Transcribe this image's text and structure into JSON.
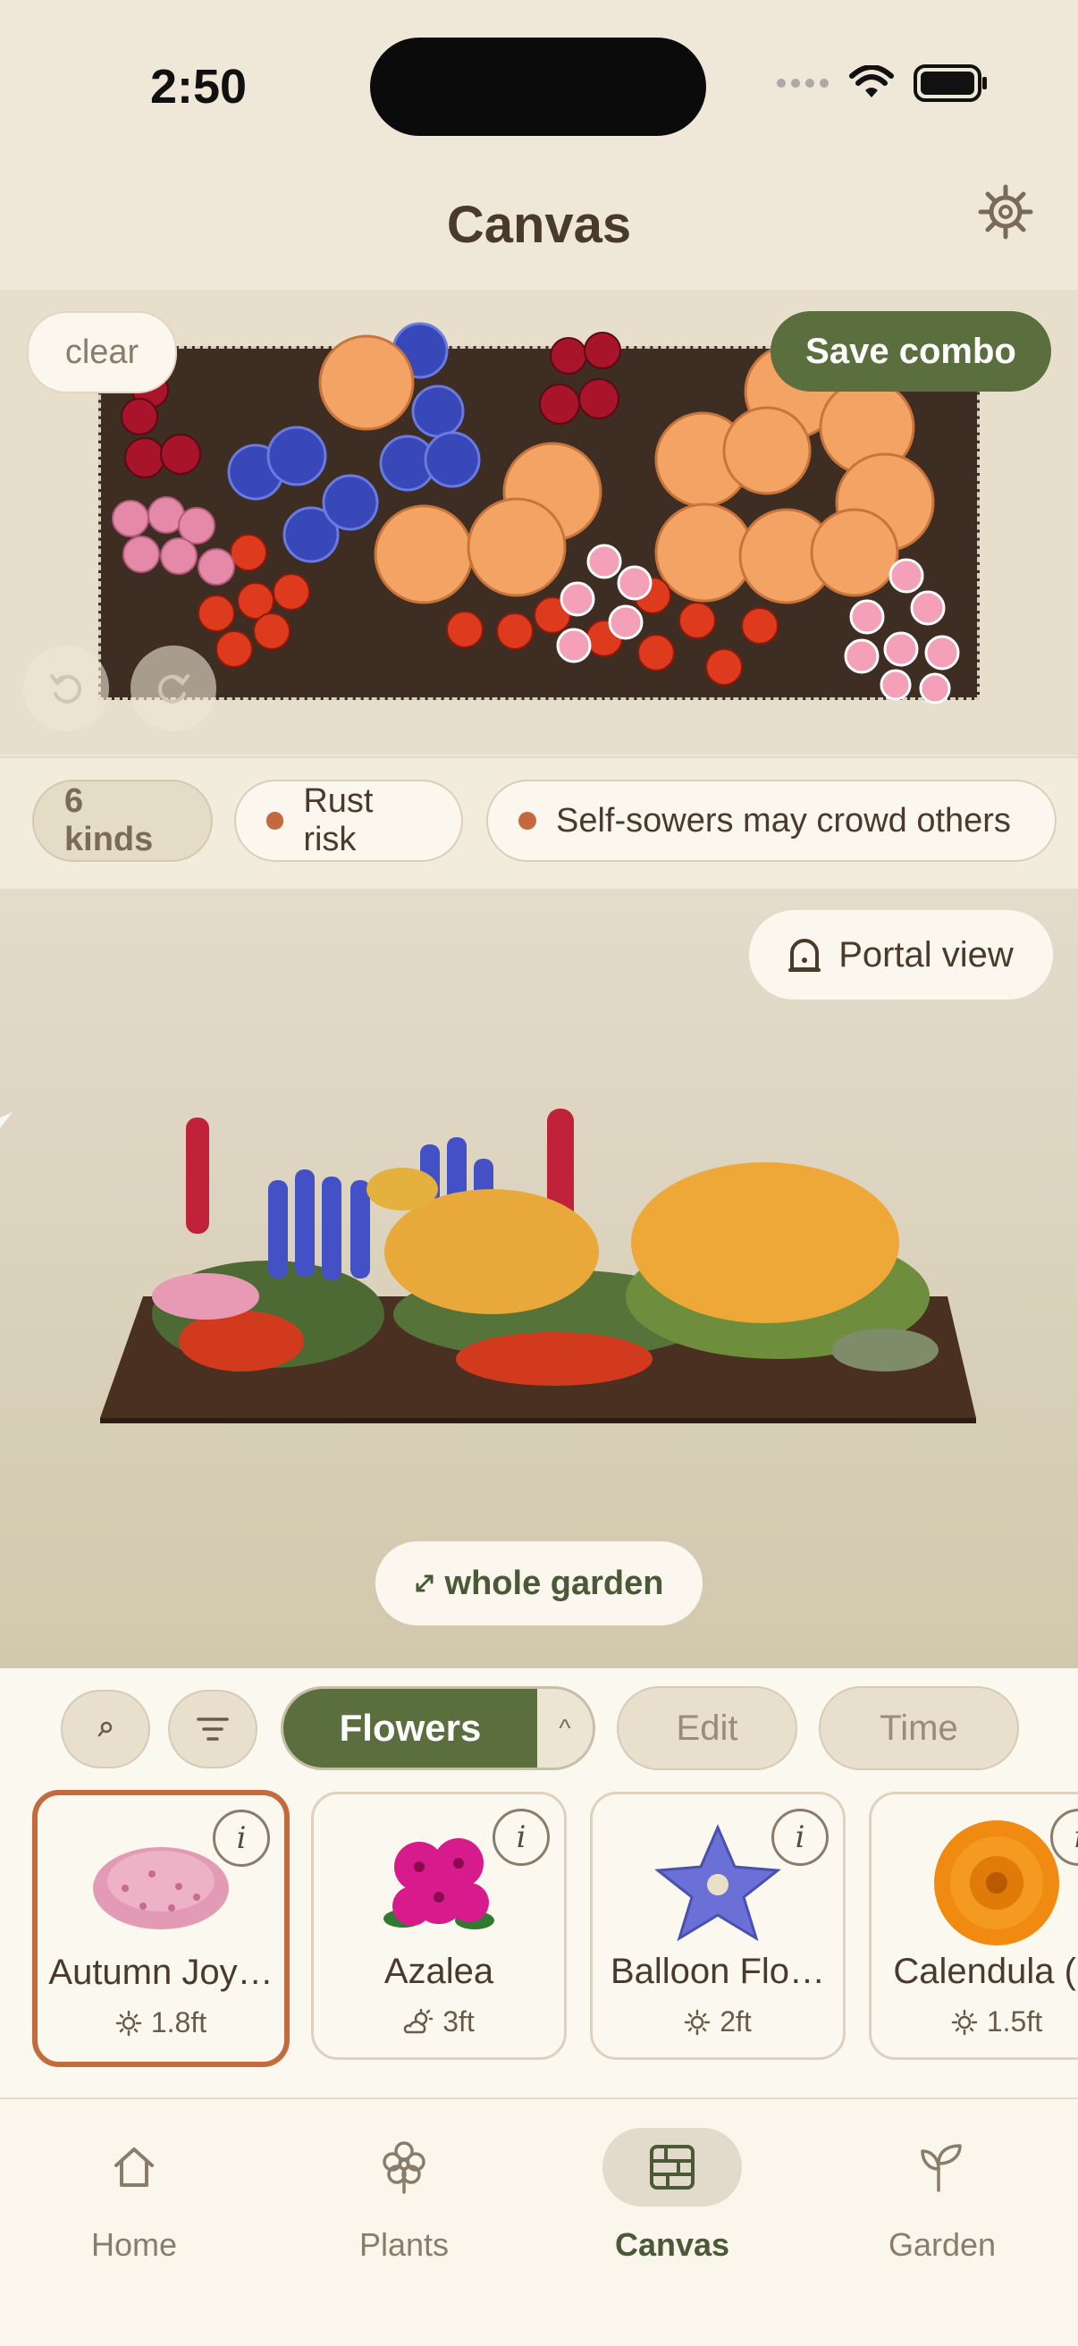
{
  "status": {
    "time": "2:50"
  },
  "header": {
    "title": "Canvas",
    "settings_icon": "gear-icon"
  },
  "canvas": {
    "clear_label": "clear",
    "save_label": "Save combo",
    "undo_icon": "undo-icon",
    "redo_icon": "redo-icon"
  },
  "tags": {
    "kinds": "6 kinds",
    "warnings": [
      "Rust risk",
      "Self-sowers may crowd others"
    ],
    "warning_color": "#C4683E"
  },
  "view3d": {
    "portal_label": "Portal view",
    "portal_icon": "portal-icon",
    "whole_garden_label": "whole garden",
    "expand_icon": "expand-icon"
  },
  "toolbar": {
    "search_icon": "search-icon",
    "filter_icon": "filter-icon",
    "category": "Flowers",
    "caret": "^",
    "edit_label": "Edit",
    "time_label": "Time",
    "accent": "#5A6E3E"
  },
  "plants": [
    {
      "name": "Autumn Joy…",
      "height": "1.8ft",
      "light": "sun-icon",
      "selected": true
    },
    {
      "name": "Azalea",
      "height": "3ft",
      "light": "partial-sun-icon",
      "selected": false
    },
    {
      "name": "Balloon Flo…",
      "height": "2ft",
      "light": "sun-icon",
      "selected": false
    },
    {
      "name": "Calendula (P",
      "height": "1.5ft",
      "light": "sun-icon",
      "selected": false
    }
  ],
  "plant_info_label": "i",
  "tabs": [
    {
      "label": "Home",
      "icon": "home-icon",
      "active": false
    },
    {
      "label": "Plants",
      "icon": "flower-icon",
      "active": false
    },
    {
      "label": "Canvas",
      "icon": "canvas-icon",
      "active": true
    },
    {
      "label": "Garden",
      "icon": "sprout-icon",
      "active": false
    }
  ]
}
